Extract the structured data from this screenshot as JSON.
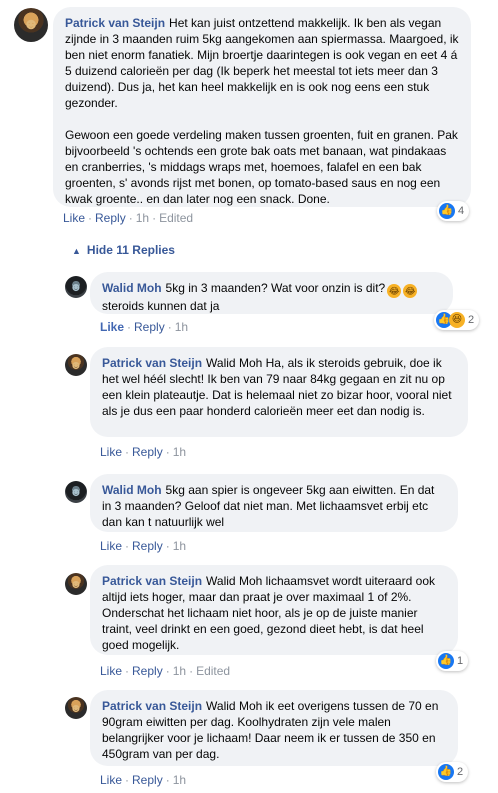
{
  "comments": [
    {
      "author": "Patrick van Steijn",
      "paragraphs": [
        "Het kan juist ontzettend makkelijk. Ik ben als vegan zijnde in 3 maanden ruim 5kg aangekomen aan spiermassa. Maargoed, ik ben niet enorm fanatiek. Mijn broertje daarintegen is ook vegan en eet 4 á 5 duizend calorieën per dag (Ik beperk het meestal tot iets meer dan 3 duizend). Dus ja, het kan heel makkelijk en is ook nog eens een stuk gezonder.",
        "Gewoon een goede verdeling maken tussen groenten, fuit en granen. Pak bijvoorbeeld 's ochtends een grote bak oats met banaan, wat pindakaas en cranberries, 's middags wraps met, hoemoes, falafel en een bak groenten, s' avonds rijst met bonen, op tomato-based saus en nog een kwak groente.. en dan later nog een snack. Done."
      ],
      "actions": {
        "like": "Like",
        "reply": "Reply",
        "time": "1h",
        "edited": "Edited"
      },
      "reactions": {
        "count": "4",
        "icon": "like-icon"
      }
    }
  ],
  "hide_replies": {
    "label": "Hide 11 Replies",
    "icon": "caret-up-icon"
  },
  "replies": [
    {
      "author": "Walid Moh",
      "text": "5kg in 3 maanden? Wat voor onzin is dit?",
      "text_after": "steroids kunnen dat ja",
      "emojis": [
        "laughing-emoji",
        "laughing-emoji"
      ],
      "actions": {
        "like": "Like",
        "reply": "Reply",
        "time": "1h"
      },
      "reactions": {
        "count": "2",
        "icon": "like-icon",
        "icon2": "haha-icon"
      }
    },
    {
      "author": "Patrick van Steijn",
      "text": "Walid Moh Ha, als ik steroids gebruik, doe ik het wel héél slecht! Ik ben van 79 naar 84kg gegaan en zit nu op een klein plateautje. Dat is helemaal niet zo bizar hoor, vooral niet als je dus een paar honderd calorieën meer eet dan nodig is.",
      "actions": {
        "like": "Like",
        "reply": "Reply",
        "time": "1h"
      }
    },
    {
      "author": "Walid Moh",
      "text": "5kg aan spier is ongeveer 5kg aan eiwitten. En dat in 3 maanden? Geloof dat niet man. Met lichaamsvet erbij etc dan kan t natuurlijk wel",
      "actions": {
        "like": "Like",
        "reply": "Reply",
        "time": "1h"
      }
    },
    {
      "author": "Patrick van Steijn",
      "text": "Walid Moh lichaamsvet wordt uiteraard ook altijd iets hoger, maar dan praat je over maximaal 1 of 2%. Onderschat het lichaam niet hoor, als je op de juiste manier traint, veel drinkt en een goed, gezond dieet hebt, is dat heel goed mogelijk.",
      "actions": {
        "like": "Like",
        "reply": "Reply",
        "time": "1h",
        "edited": "Edited"
      },
      "reactions": {
        "count": "1",
        "icon": "like-icon"
      }
    },
    {
      "author": "Patrick van Steijn",
      "text": "Walid Moh ik eet overigens tussen de 70 en 90gram eiwitten per dag. Koolhydraten zijn vele malen belangrijker voor je lichaam! Daar neem ik er tussen de 350 en 450gram van per dag.",
      "actions": {
        "like": "Like",
        "reply": "Reply",
        "time": "1h"
      },
      "reactions": {
        "count": "2",
        "icon": "like-icon"
      }
    }
  ],
  "colors": {
    "name": "#385898",
    "bubble": "#f0f2f5",
    "like_blue": "#1877f2"
  }
}
